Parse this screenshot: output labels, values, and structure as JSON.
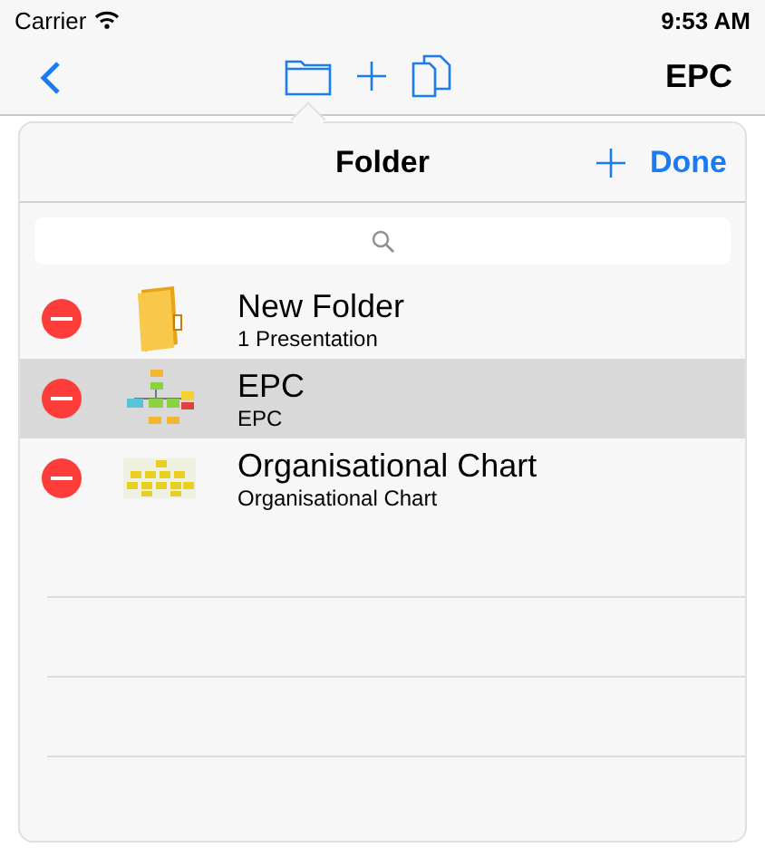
{
  "status_bar": {
    "carrier": "Carrier",
    "time": "9:53 AM"
  },
  "nav_bar": {
    "title": "EPC"
  },
  "popover": {
    "title": "Folder",
    "done": "Done"
  },
  "rows": [
    {
      "kind": "folder",
      "title": "New Folder",
      "subtitle": "1 Presentation",
      "selected": false
    },
    {
      "kind": "flow",
      "title": "EPC",
      "subtitle": "EPC",
      "selected": true
    },
    {
      "kind": "org",
      "title": "Organisational Chart",
      "subtitle": "Organisational Chart",
      "selected": false
    }
  ]
}
